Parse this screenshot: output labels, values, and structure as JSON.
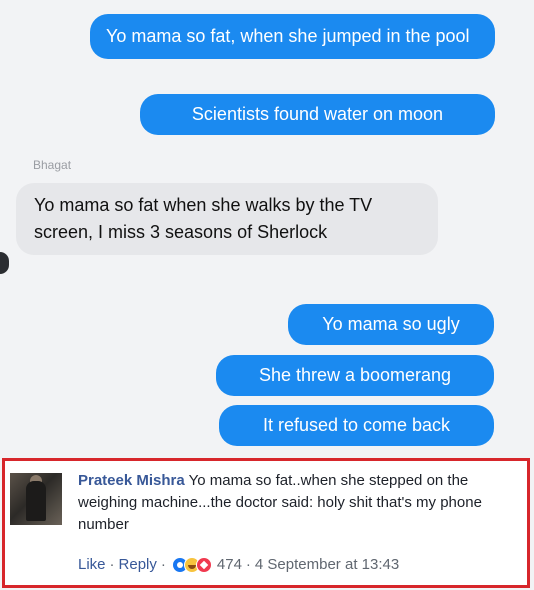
{
  "messages": [
    {
      "text": "Yo mama so fat, when she jumped in the pool"
    },
    {
      "text": "Scientists found water on moon"
    },
    {
      "text": "Yo mama so fat when she walks by the TV screen, I miss 3 seasons of Sherlock"
    },
    {
      "text": "Yo mama so ugly"
    },
    {
      "text": "She threw a boomerang"
    },
    {
      "text": "It refused to come back"
    }
  ],
  "sender_name": "Bhagat",
  "colors": {
    "outgoing_bubble": "#1b8af0",
    "incoming_bubble": "#e6e7ea",
    "highlight_border": "#d7262b",
    "author_link": "#385898"
  },
  "comment": {
    "author": "Prateek Mishra",
    "text": "Yo mama so fat..when she stepped on the weighing machine...the doctor said: holy shit that's my phone number",
    "actions": {
      "like": "Like",
      "reply": "Reply"
    },
    "reaction_icons": [
      "like-icon",
      "haha-icon",
      "love-icon"
    ],
    "reaction_count": "474",
    "timestamp": "4 September at 13:43"
  }
}
